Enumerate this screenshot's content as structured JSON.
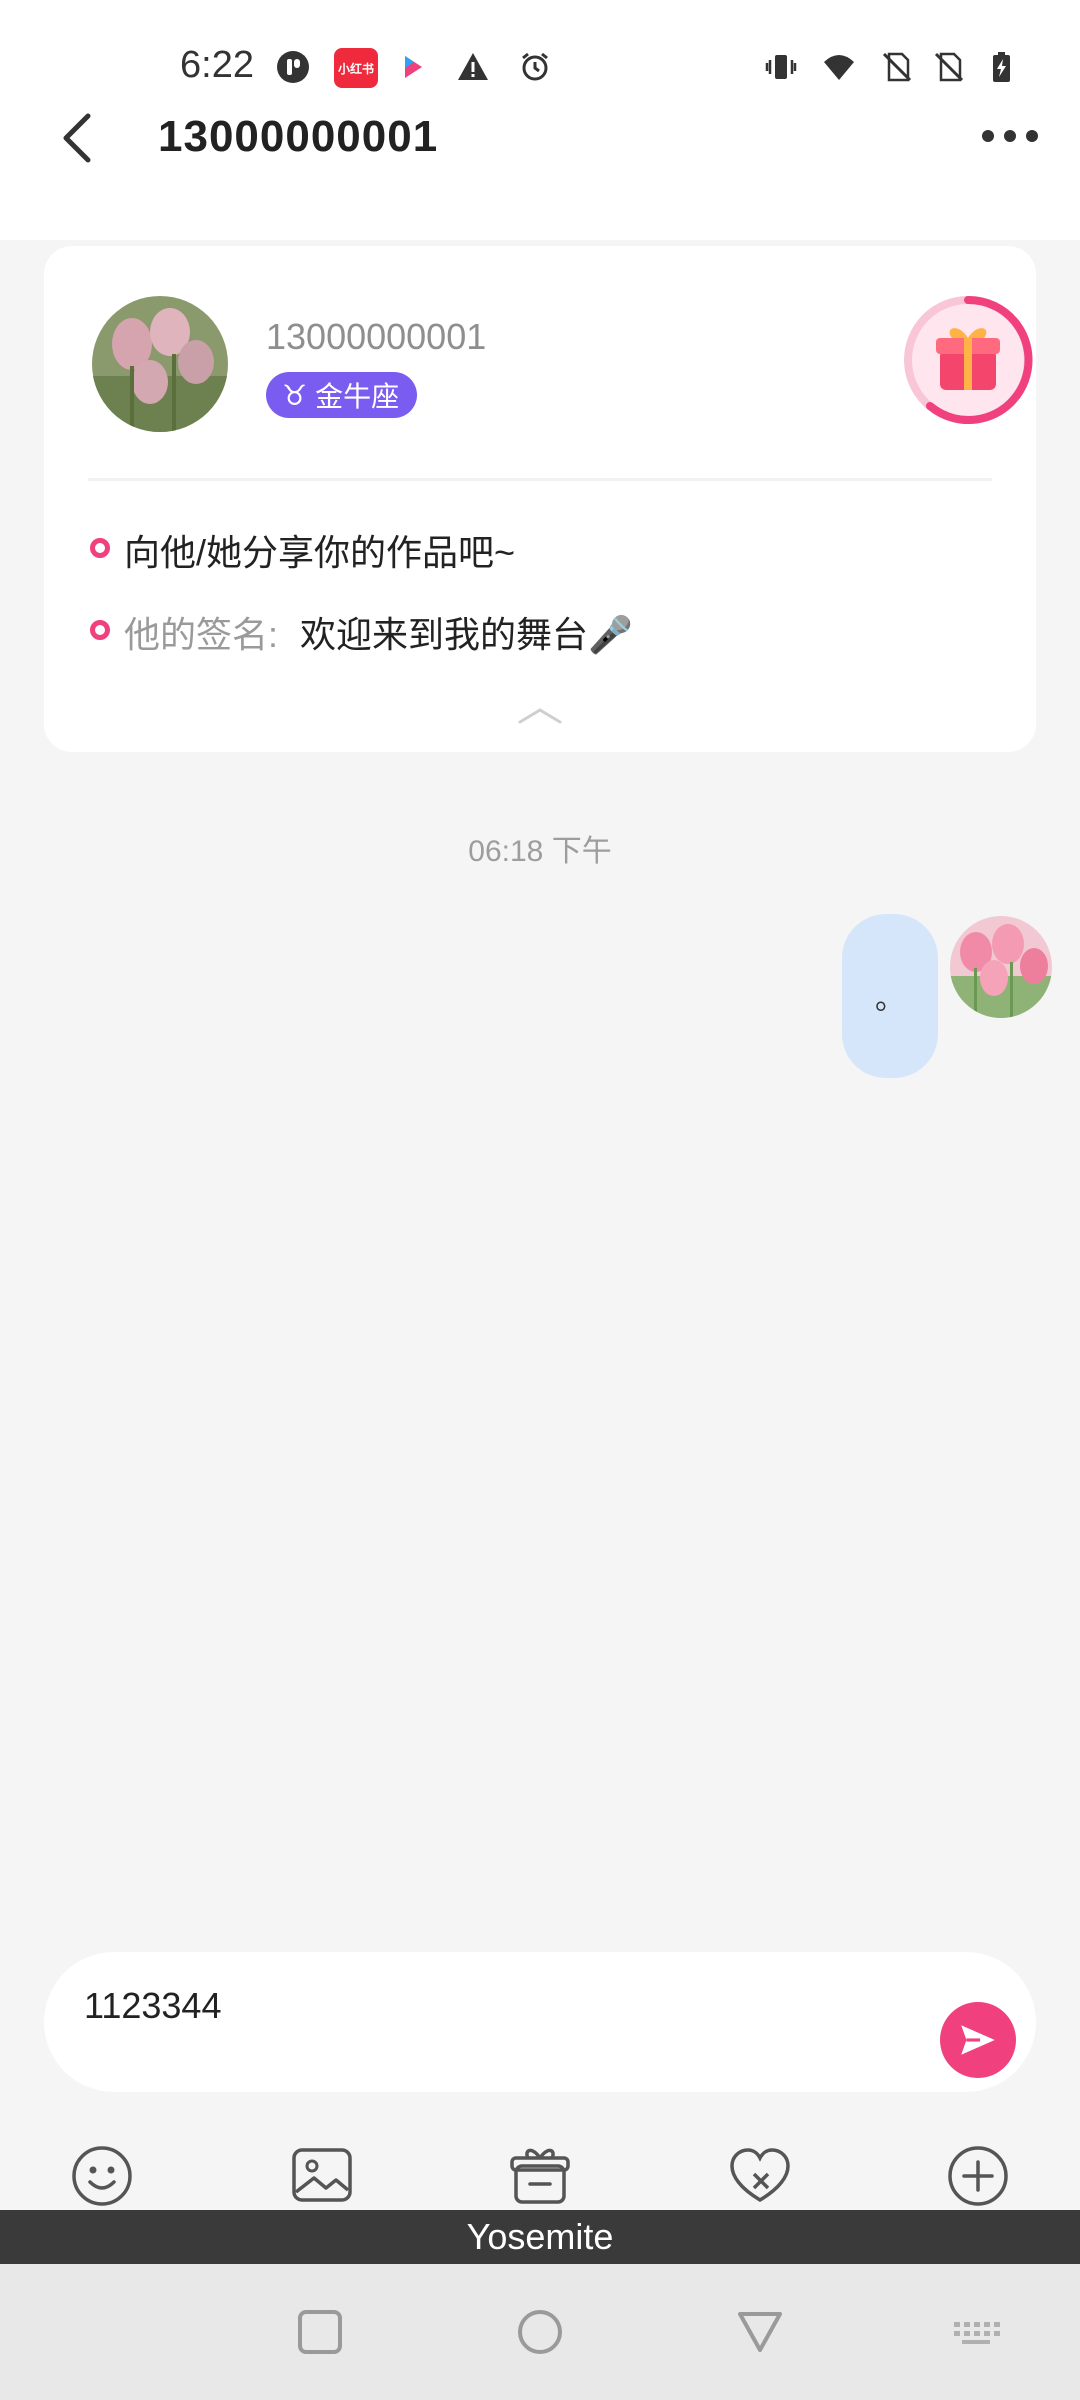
{
  "status_bar": {
    "time": "6:22",
    "left_icons": [
      "podcast-app-icon",
      "xiaohongshu-icon",
      "video-app-icon",
      "warning-icon",
      "alarm-icon"
    ],
    "right_icons": [
      "vibrate-icon",
      "wifi-icon",
      "no-sim-icon",
      "no-sim-2-icon",
      "battery-charging-icon"
    ],
    "xiaohongshu_label": "小红书"
  },
  "header": {
    "title": "13000000001"
  },
  "profile_card": {
    "name": "13000000001",
    "zodiac_symbol": "♉",
    "zodiac": "金牛座",
    "share_prompt": "向他/她分享你的作品吧~",
    "signature_label": "他的签名:",
    "signature_value": "欢迎来到我的舞台🎤"
  },
  "chat": {
    "timestamp": "06:18 下午",
    "messages": [
      {
        "side": "right",
        "text": "。"
      }
    ]
  },
  "composer": {
    "value": "1123344"
  },
  "toolbar": {
    "items": [
      "emoji-icon",
      "image-icon",
      "gift-icon",
      "sticker-icon",
      "plus-icon"
    ]
  },
  "overlay_bar": {
    "text": "Yosemite"
  },
  "colors": {
    "accent": "#f0407e",
    "zodiac_badge": "#7b5cf0",
    "bubble": "#d5e6fb",
    "background": "#f5f5f6"
  }
}
